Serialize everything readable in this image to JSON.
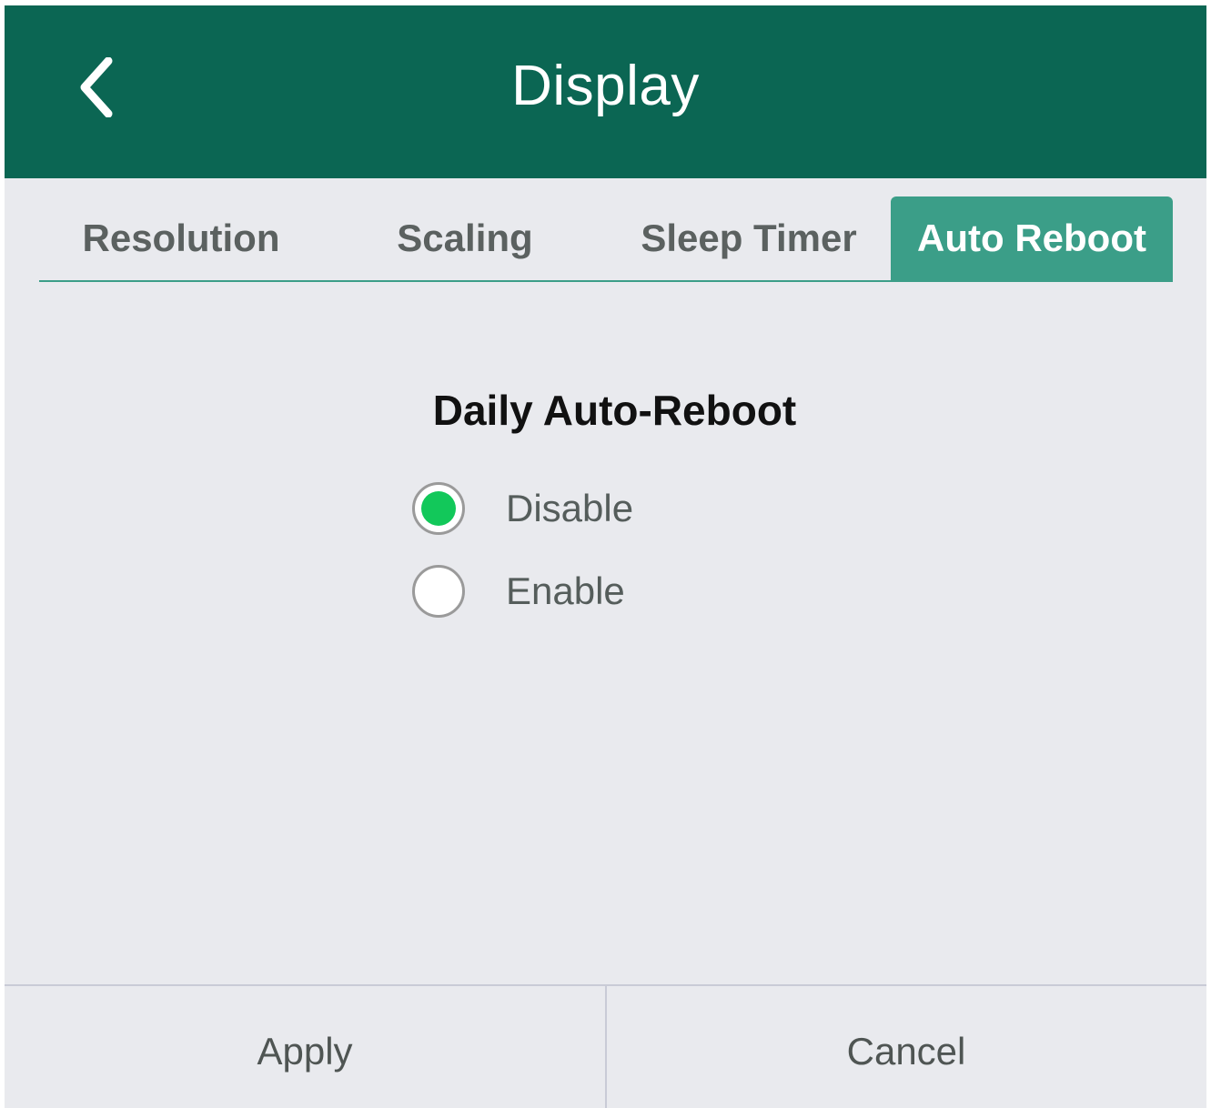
{
  "header": {
    "title": "Display",
    "back_icon": "chevron-left-icon",
    "background_color": "#0b6653"
  },
  "tabs": [
    {
      "label": "Resolution",
      "selected": false
    },
    {
      "label": "Scaling",
      "selected": false
    },
    {
      "label": "Sleep Timer",
      "selected": false
    },
    {
      "label": "Auto Reboot",
      "selected": true
    }
  ],
  "accent_color": "#3b9e88",
  "content": {
    "section_title": "Daily Auto-Reboot",
    "options": [
      {
        "label": "Disable",
        "checked": true
      },
      {
        "label": "Enable",
        "checked": false
      }
    ],
    "radio_checked_color": "#12c85a"
  },
  "footer": {
    "apply_label": "Apply",
    "cancel_label": "Cancel"
  }
}
